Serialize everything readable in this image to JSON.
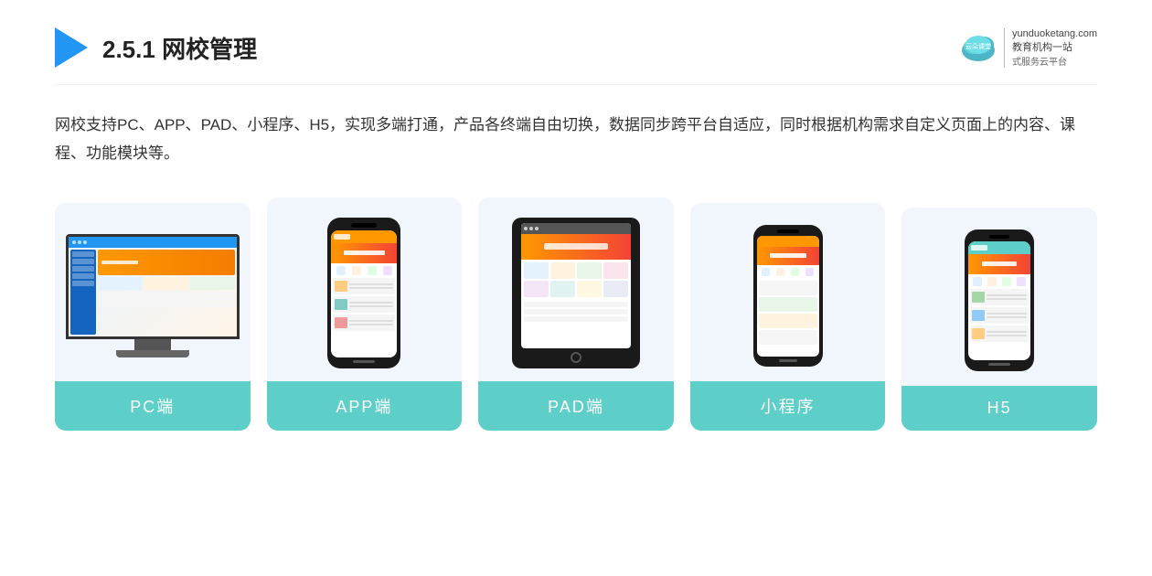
{
  "header": {
    "section_number": "2.5.1",
    "title_plain": "2.5.1 ",
    "title_bold": "网校管理",
    "brand_url": "yunduoketang.com",
    "brand_tagline1": "教育机构一站",
    "brand_tagline2": "式服务云平台"
  },
  "description": {
    "text": "网校支持PC、APP、PAD、小程序、H5，实现多端打通，产品各终端自由切换，数据同步跨平台自适应，同时根据机构需求自定义页面上的内容、课程、功能模块等。"
  },
  "cards": [
    {
      "id": "pc",
      "label": "PC端",
      "type": "desktop"
    },
    {
      "id": "app",
      "label": "APP端",
      "type": "phone"
    },
    {
      "id": "pad",
      "label": "PAD端",
      "type": "tablet"
    },
    {
      "id": "miniapp",
      "label": "小程序",
      "type": "mini-phone"
    },
    {
      "id": "h5",
      "label": "H5",
      "type": "phone2"
    }
  ]
}
